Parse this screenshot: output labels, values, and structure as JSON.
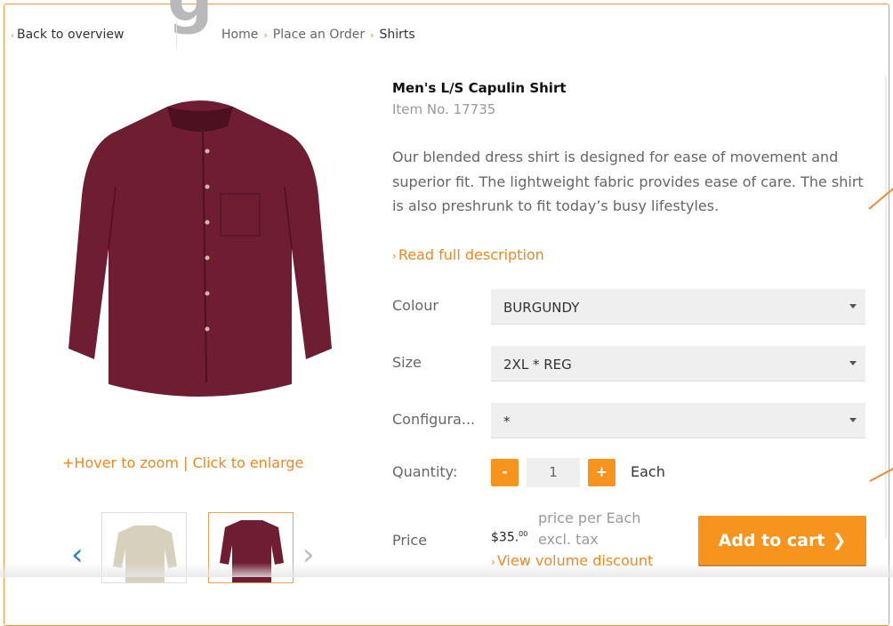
{
  "nav": {
    "back_chevron": "‹",
    "back_label": "Back to overview",
    "breadcrumb": [
      "Home",
      "Place an Order",
      "Shirts"
    ],
    "breadcrumb_sep": "›"
  },
  "product": {
    "title": "Men's L/S Capulin Shirt",
    "item_no": "Item No.  17735",
    "description": "Our blended dress shirt is designed for ease of movement and superior fit. The lightweight fabric provides ease of care. The shirt is also preshrunk to fit today’s busy lifestyles.",
    "read_more": "Read full description",
    "image_color": "#6e1d33",
    "zoom_hint": "+Hover to zoom | Click to enlarge"
  },
  "options": {
    "colour_label": "Colour",
    "colour_value": "BURGUNDY",
    "size_label": "Size",
    "size_value": "2XL * REG",
    "config_label": "Configura...",
    "config_value": "*"
  },
  "quantity": {
    "label": "Quantity:",
    "minus": "-",
    "value": "1",
    "plus": "+",
    "unit": "Each"
  },
  "price": {
    "label": "Price",
    "amount": "$35.",
    "cents": "00",
    "per": "price per Each",
    "tax": "excl. tax",
    "volume_link": "View volume discount"
  },
  "cart": {
    "label": "Add to cart",
    "chevron": "❯"
  },
  "colors": {
    "accent": "#f7941e",
    "link": "#f0871f",
    "nav_blue": "#2f7dd1"
  }
}
